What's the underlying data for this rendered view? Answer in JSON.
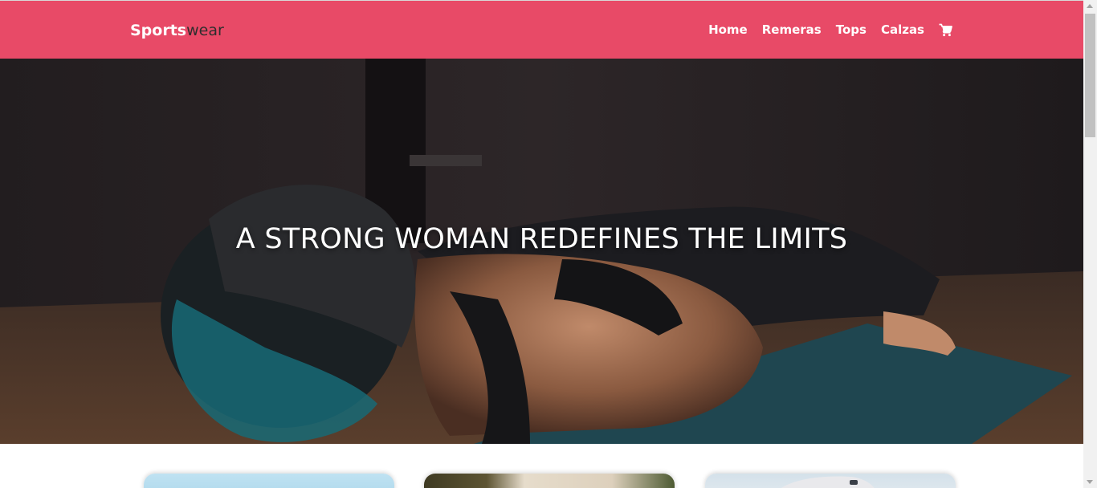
{
  "brand": {
    "part1": "Sports",
    "part2": "wear"
  },
  "nav": {
    "items": [
      "Home",
      "Remeras",
      "Tops",
      "Calzas"
    ],
    "cart_icon": "cart-icon"
  },
  "hero": {
    "title": "A STRONG WOMAN REDEFINES THE LIMITS"
  },
  "colors": {
    "navbar": "#e84a67",
    "brand_dark": "#2e2e2e"
  }
}
